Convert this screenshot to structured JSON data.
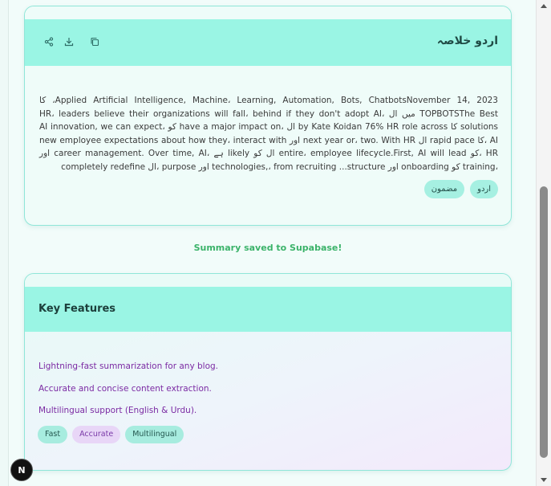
{
  "summary_card": {
    "title": "اردو خلاصہ",
    "icons": [
      "share-icon",
      "download-icon",
      "copy-icon"
    ],
    "body": "Applied Artificial Intelligence, Machine، Learning, Automation, Bots, ChatbotsNovember 14, 2023، کا TOPBOTSThe Best میں ال HR، leaders believe their organizations will fall، behind if they don't adopt AI، solutions کا by Kate Koidan 76% HR role across ال ،have a major impact on کو ،AI innovation, we can expect AI ،کا rapid pace ال next year or، two. With HR اور new employee expectations about how they، interact with HR ،کو entire، employee lifecycle.First, AI will lead ال کو likely ہے ،career management. Over time, AI اور ،training کو onboarding اور technologies,، from recruiting ...structure اور purpose ،ال completely redefine",
    "tags": [
      "اردو",
      "مضمون"
    ]
  },
  "status": {
    "saved_message": "Summary saved to Supabase!"
  },
  "features_card": {
    "title": "Key Features",
    "items": [
      "Lightning-fast summarization for any blog.",
      "Accurate and concise content extraction.",
      "Multilingual support (English & Urdu)."
    ],
    "tags": [
      "Fast",
      "Accurate",
      "Multilingual"
    ]
  },
  "colors": {
    "accent": "#9af5e4",
    "feature_text": "#7b2aa3",
    "saved_text": "#3bb36a"
  },
  "badge": {
    "label": "N"
  }
}
